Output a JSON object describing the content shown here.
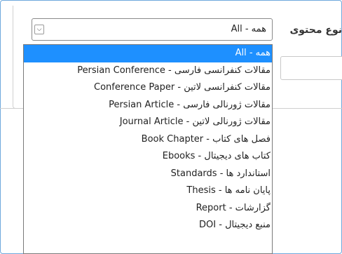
{
  "form": {
    "content_type_label": "نوع محتوی",
    "select": {
      "current_value": "All - همه",
      "arrow": "chevron-down-icon",
      "selected_index": 0,
      "options": [
        "All - همه",
        "Persian Conference - مقالات کنفرانسی فارسی",
        "Conference Paper - مقالات کنفرانسی لاتین",
        "Persian Article - مقالات ژورنالی فارسی",
        "Journal Article - مقالات ژورنالی لاتین",
        "Book Chapter - فصل های کتاب",
        "Ebooks - کتاب های دیجیتال",
        "Standards - استاندارد ها",
        "Thesis - پایان نامه ها",
        "Report - گزارشات",
        "DOI - منبع دیجیتال"
      ]
    }
  },
  "colors": {
    "highlight": "#1e90ff",
    "frame_border": "#6fa8dc"
  }
}
